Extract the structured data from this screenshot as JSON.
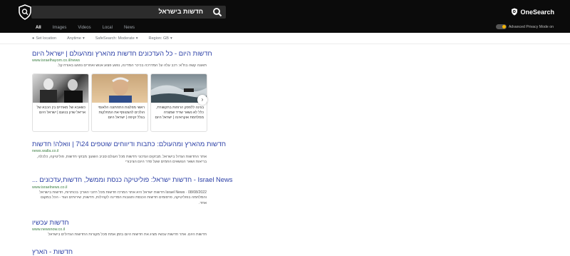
{
  "header": {
    "search_query": "חדשות בישראל",
    "brand": "OneSearch",
    "privacy_label": "Advanced Privacy Mode on",
    "tabs": [
      "All",
      "Images",
      "Videos",
      "Local",
      "News"
    ]
  },
  "filters": {
    "location": "Set location",
    "time": "Anytime",
    "safesearch": "SafeSearch: Moderate",
    "region": "Region: GB"
  },
  "results": [
    {
      "title": "חדשות היום - כל העדכונים חדשות מהארץ ומהעולם | ישראל היום",
      "url": "www.israelhayom.co.il/news",
      "snippet": "תאונה קשה בת\"א: רכב עלה על המדרכה בכיכר המדינה, נפגע פצוע אנוש ואחרים נפגעו באורח קל."
    },
    {
      "title": "חדשות מהארץ ומהעולם: כתבות ודיווחים שוטפים 24\\7 | וואלה! חדשות",
      "url": "news.walla.co.il",
      "snippet": "אתר החדשות הגדול בישראל. מבזקים ועדכוני חדשות מכל העולם סביב השעון: מבזקי חדשות, פוליטיקה, כלכלה, בריאות ושאר הנושאים החמים שעל סדר היום הציבורי"
    },
    {
      "title": "Israel News - חדשות ישראל: פוליטיקה כנסת וממשל, חדשות,עדכונים ...",
      "url": "www.israelnews.co.il",
      "snippet": "08/08/2022 · Israel News חדשות ישראל היא אתר המרכז חדשות מכל רחבי הארץ: בכותרות, חדשות בישראל והמלחמה בפוליטיקה, פרסומים חדשות הכנסת ותגובות המדינה לקהילות, חדשות, שירותים ועוד - הכל במקום אחד."
    },
    {
      "title": "חדשות עכשיו",
      "url": "www.newsnow.co.il",
      "snippet": "חדשות היום. אתר חדשות עכשיו מציג את חדשות היום בזמן אמת מכל מקורות החדשות הגדולים בישראל"
    },
    {
      "title": "חדשות - הארץ",
      "url": "",
      "snippet": ""
    }
  ],
  "news_cards": [
    {
      "caption": "כשאבא של מאתיים בין הכבא של אריאל שרון בנועם | ישראל היום"
    },
    {
      "caption": "ראשי מפלגות התחתונה הלאומי הולכים להצטופף את המחלקות בגלל זקיפה | ישראל היום"
    },
    {
      "caption": "בגינה ללפסק הרוחות בתקשורת, כלל לא נשאר שריד שמצרה ממלחמת אוקראינה | ישראל היום"
    }
  ]
}
